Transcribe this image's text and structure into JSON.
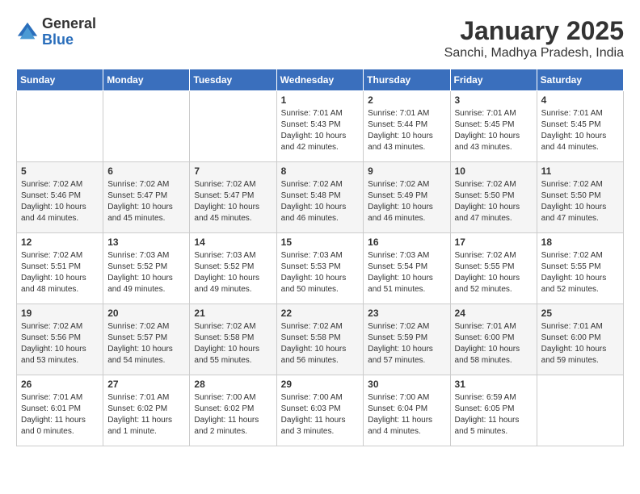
{
  "logo": {
    "general": "General",
    "blue": "Blue"
  },
  "title": "January 2025",
  "location": "Sanchi, Madhya Pradesh, India",
  "weekdays": [
    "Sunday",
    "Monday",
    "Tuesday",
    "Wednesday",
    "Thursday",
    "Friday",
    "Saturday"
  ],
  "weeks": [
    [
      {
        "day": "",
        "info": ""
      },
      {
        "day": "",
        "info": ""
      },
      {
        "day": "",
        "info": ""
      },
      {
        "day": "1",
        "info": "Sunrise: 7:01 AM\nSunset: 5:43 PM\nDaylight: 10 hours and 42 minutes."
      },
      {
        "day": "2",
        "info": "Sunrise: 7:01 AM\nSunset: 5:44 PM\nDaylight: 10 hours and 43 minutes."
      },
      {
        "day": "3",
        "info": "Sunrise: 7:01 AM\nSunset: 5:45 PM\nDaylight: 10 hours and 43 minutes."
      },
      {
        "day": "4",
        "info": "Sunrise: 7:01 AM\nSunset: 5:45 PM\nDaylight: 10 hours and 44 minutes."
      }
    ],
    [
      {
        "day": "5",
        "info": "Sunrise: 7:02 AM\nSunset: 5:46 PM\nDaylight: 10 hours and 44 minutes."
      },
      {
        "day": "6",
        "info": "Sunrise: 7:02 AM\nSunset: 5:47 PM\nDaylight: 10 hours and 45 minutes."
      },
      {
        "day": "7",
        "info": "Sunrise: 7:02 AM\nSunset: 5:47 PM\nDaylight: 10 hours and 45 minutes."
      },
      {
        "day": "8",
        "info": "Sunrise: 7:02 AM\nSunset: 5:48 PM\nDaylight: 10 hours and 46 minutes."
      },
      {
        "day": "9",
        "info": "Sunrise: 7:02 AM\nSunset: 5:49 PM\nDaylight: 10 hours and 46 minutes."
      },
      {
        "day": "10",
        "info": "Sunrise: 7:02 AM\nSunset: 5:50 PM\nDaylight: 10 hours and 47 minutes."
      },
      {
        "day": "11",
        "info": "Sunrise: 7:02 AM\nSunset: 5:50 PM\nDaylight: 10 hours and 47 minutes."
      }
    ],
    [
      {
        "day": "12",
        "info": "Sunrise: 7:02 AM\nSunset: 5:51 PM\nDaylight: 10 hours and 48 minutes."
      },
      {
        "day": "13",
        "info": "Sunrise: 7:03 AM\nSunset: 5:52 PM\nDaylight: 10 hours and 49 minutes."
      },
      {
        "day": "14",
        "info": "Sunrise: 7:03 AM\nSunset: 5:52 PM\nDaylight: 10 hours and 49 minutes."
      },
      {
        "day": "15",
        "info": "Sunrise: 7:03 AM\nSunset: 5:53 PM\nDaylight: 10 hours and 50 minutes."
      },
      {
        "day": "16",
        "info": "Sunrise: 7:03 AM\nSunset: 5:54 PM\nDaylight: 10 hours and 51 minutes."
      },
      {
        "day": "17",
        "info": "Sunrise: 7:02 AM\nSunset: 5:55 PM\nDaylight: 10 hours and 52 minutes."
      },
      {
        "day": "18",
        "info": "Sunrise: 7:02 AM\nSunset: 5:55 PM\nDaylight: 10 hours and 52 minutes."
      }
    ],
    [
      {
        "day": "19",
        "info": "Sunrise: 7:02 AM\nSunset: 5:56 PM\nDaylight: 10 hours and 53 minutes."
      },
      {
        "day": "20",
        "info": "Sunrise: 7:02 AM\nSunset: 5:57 PM\nDaylight: 10 hours and 54 minutes."
      },
      {
        "day": "21",
        "info": "Sunrise: 7:02 AM\nSunset: 5:58 PM\nDaylight: 10 hours and 55 minutes."
      },
      {
        "day": "22",
        "info": "Sunrise: 7:02 AM\nSunset: 5:58 PM\nDaylight: 10 hours and 56 minutes."
      },
      {
        "day": "23",
        "info": "Sunrise: 7:02 AM\nSunset: 5:59 PM\nDaylight: 10 hours and 57 minutes."
      },
      {
        "day": "24",
        "info": "Sunrise: 7:01 AM\nSunset: 6:00 PM\nDaylight: 10 hours and 58 minutes."
      },
      {
        "day": "25",
        "info": "Sunrise: 7:01 AM\nSunset: 6:00 PM\nDaylight: 10 hours and 59 minutes."
      }
    ],
    [
      {
        "day": "26",
        "info": "Sunrise: 7:01 AM\nSunset: 6:01 PM\nDaylight: 11 hours and 0 minutes."
      },
      {
        "day": "27",
        "info": "Sunrise: 7:01 AM\nSunset: 6:02 PM\nDaylight: 11 hours and 1 minute."
      },
      {
        "day": "28",
        "info": "Sunrise: 7:00 AM\nSunset: 6:02 PM\nDaylight: 11 hours and 2 minutes."
      },
      {
        "day": "29",
        "info": "Sunrise: 7:00 AM\nSunset: 6:03 PM\nDaylight: 11 hours and 3 minutes."
      },
      {
        "day": "30",
        "info": "Sunrise: 7:00 AM\nSunset: 6:04 PM\nDaylight: 11 hours and 4 minutes."
      },
      {
        "day": "31",
        "info": "Sunrise: 6:59 AM\nSunset: 6:05 PM\nDaylight: 11 hours and 5 minutes."
      },
      {
        "day": "",
        "info": ""
      }
    ]
  ]
}
